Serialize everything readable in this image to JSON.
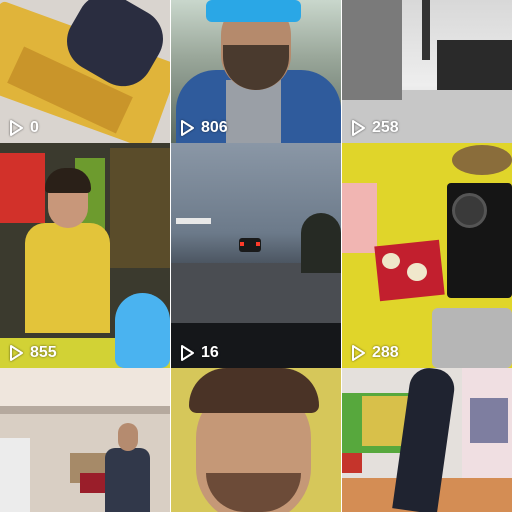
{
  "grid": {
    "tiles": [
      {
        "views": "0"
      },
      {
        "views": "806"
      },
      {
        "views": "258"
      },
      {
        "views": "855"
      },
      {
        "views": "16"
      },
      {
        "views": "288"
      },
      {
        "views": ""
      },
      {
        "views": ""
      },
      {
        "views": ""
      }
    ]
  },
  "icons": {
    "play": "play-icon"
  },
  "colors": {
    "overlay_text": "#ffffff"
  }
}
